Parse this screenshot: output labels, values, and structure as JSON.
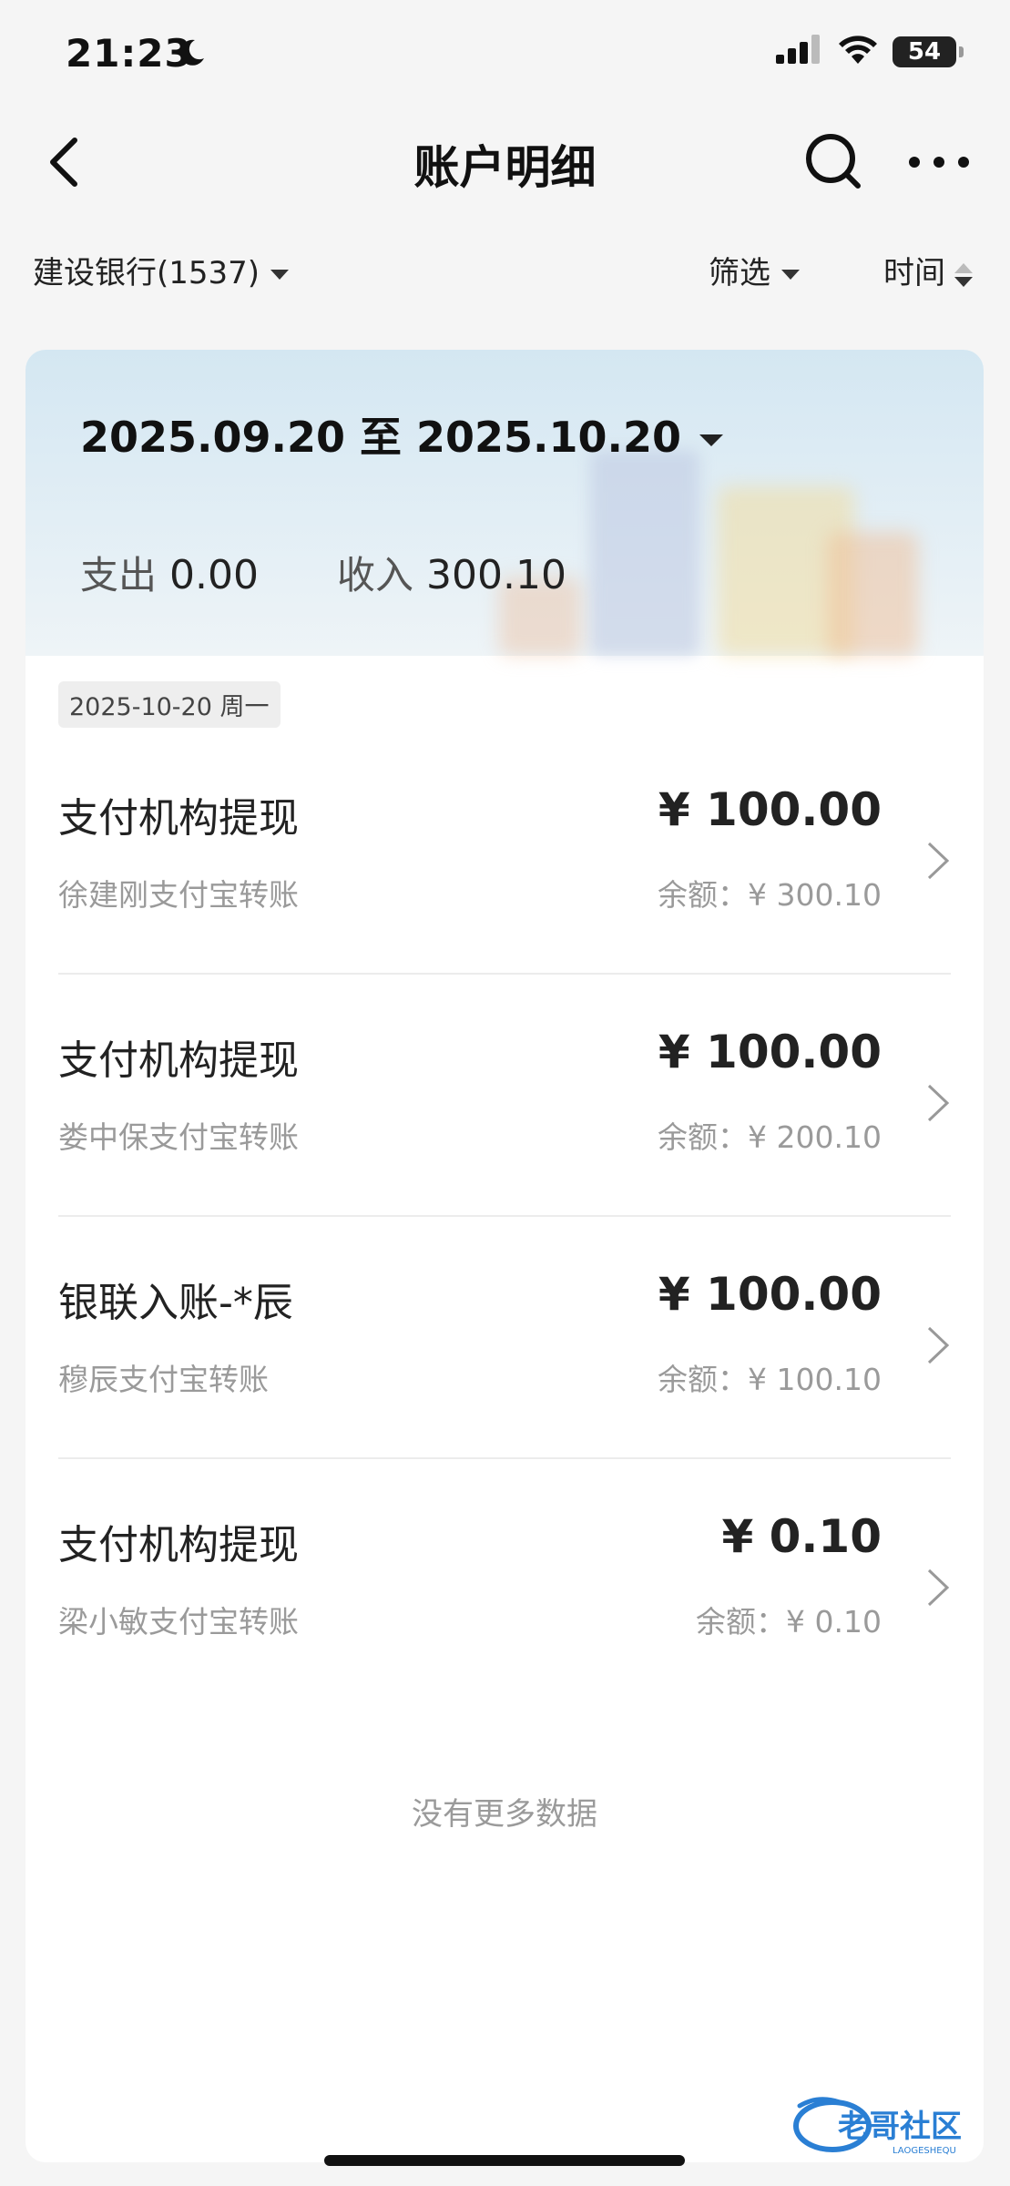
{
  "status_bar": {
    "time": "21:23",
    "battery": "54"
  },
  "nav": {
    "title": "账户明细"
  },
  "filter_bar": {
    "bank": "建设银行(1537)",
    "filter": "筛选",
    "time_sort": "时间"
  },
  "summary": {
    "date_range": "2025.09.20 至 2025.10.20",
    "expense_label": "支出",
    "expense_value": "0.00",
    "income_label": "收入",
    "income_value": "300.10"
  },
  "date_group": "2025-10-20 周一",
  "transactions": [
    {
      "title": "支付机构提现",
      "desc": "徐建刚支付宝转账",
      "amount": "¥ 100.00",
      "balance": "余额：¥ 300.10"
    },
    {
      "title": "支付机构提现",
      "desc": "娄中保支付宝转账",
      "amount": "¥ 100.00",
      "balance": "余额：¥ 200.10"
    },
    {
      "title": "银联入账-*辰",
      "desc": "穆辰支付宝转账",
      "amount": "¥ 100.00",
      "balance": "余额：¥ 100.10"
    },
    {
      "title": "支付机构提现",
      "desc": "梁小敏支付宝转账",
      "amount": "¥ 0.10",
      "balance": "余额：¥ 0.10"
    }
  ],
  "footer": {
    "no_more": "没有更多数据"
  },
  "watermark": {
    "text": "老哥社区",
    "sub": "LAOGESHEQU"
  },
  "colors": {
    "background": "#f5f5f5",
    "card": "#ffffff",
    "muted_text": "#9a9a9a",
    "watermark_blue": "#2a7fd4"
  },
  "icons": [
    "moon-icon",
    "signal-icon",
    "wifi-icon",
    "battery-icon",
    "back-arrow-icon",
    "search-icon",
    "more-icon",
    "dropdown-caret-icon",
    "sort-icon",
    "chevron-right-icon"
  ]
}
